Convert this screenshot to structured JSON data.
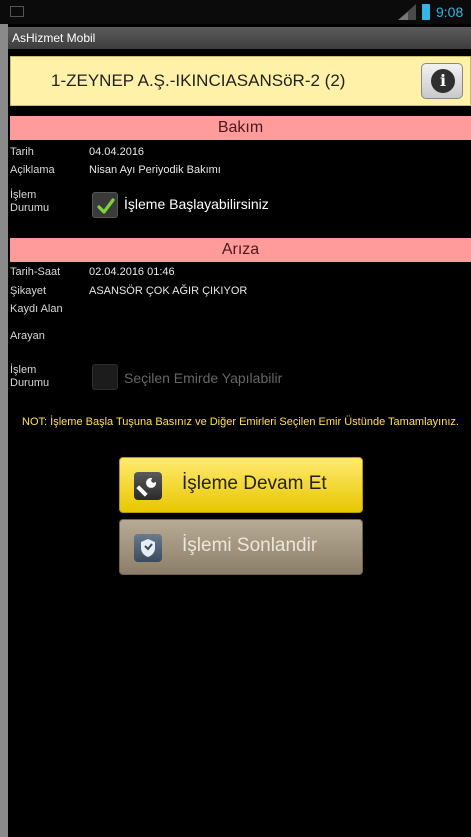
{
  "status_bar": {
    "clock": "9:08"
  },
  "app": {
    "title": "AsHizmet Mobil"
  },
  "header": {
    "title": "1-ZEYNEP A.Ş.-IKINCIASANSöR-2 (2)"
  },
  "bakim": {
    "section_title": "Bakım",
    "tarih_label": "Tarih",
    "tarih_value": "04.04.2016",
    "aciklama_label": "Açiklama",
    "aciklama_value": "Nisan Ayı Periyodik Bakımı",
    "islem_label_1": "İşlem",
    "islem_label_2": "Durumu",
    "checkbox_label": "İşleme Başlayabilirsiniz",
    "checked": true
  },
  "ariza": {
    "section_title": "Arıza",
    "tarih_saat_label": "Tarih-Saat",
    "tarih_saat_value": "02.04.2016 01:46",
    "sikayet_label": "Şikayet",
    "sikayet_value": "ASANSÖR ÇOK AĞIR ÇIKIYOR",
    "kaydi_alan_label": "Kaydı Alan",
    "arayan_label": "Arayan",
    "islem_label_1": "İşlem",
    "islem_label_2": "Durumu",
    "checkbox_label": "Seçilen Emirde Yapılabilir",
    "checked": false
  },
  "note": "NOT: İşleme Başla Tuşuna Basınız ve Diğer Emirleri Seçilen Emir Üstünde Tamamlayınız.",
  "buttons": {
    "devam": "İşleme Devam Et",
    "sonlandir": "İşlemi Sonlandir"
  },
  "colors": {
    "header_bg": "#fff2a8",
    "section_bg": "#ff9b9b",
    "note_text": "#ffe14a",
    "primary_button": "#f5d800",
    "disabled_button": "#a89b85"
  }
}
